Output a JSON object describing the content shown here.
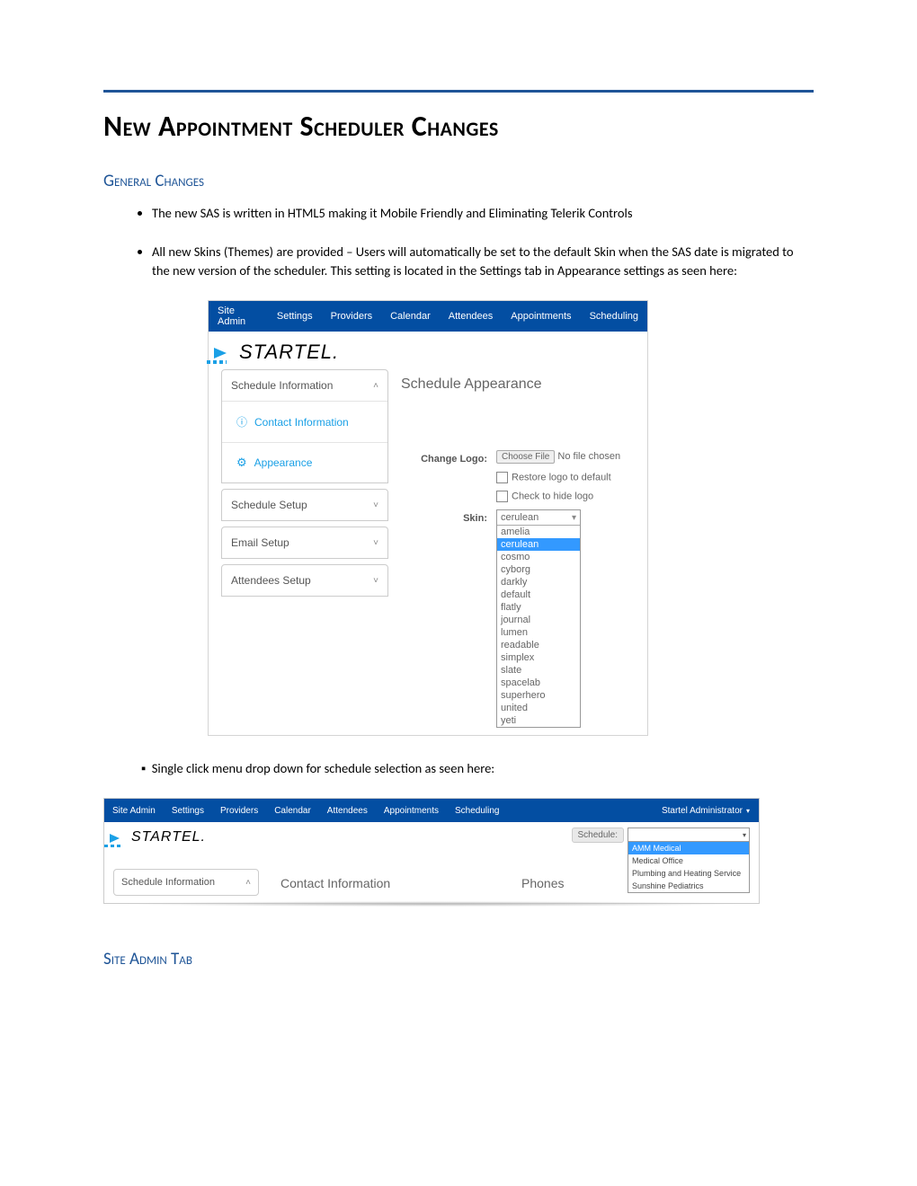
{
  "doc": {
    "title": "New Appointment Scheduler Changes",
    "section_general": "General Changes",
    "bullet1": "The new SAS is written in HTML5 making it Mobile Friendly and Eliminating Telerik Controls",
    "bullet2": "All new Skins (Themes) are provided – Users will automatically be set to the default Skin  when the SAS date is migrated to the new version of the scheduler.  This setting is located in the Settings tab in Appearance settings as seen here:",
    "bullet3": "Single click menu drop down for schedule selection as seen here:",
    "section_siteadmin": "Site Admin Tab"
  },
  "shot1": {
    "nav": [
      "Site Admin",
      "Settings",
      "Providers",
      "Calendar",
      "Attendees",
      "Appointments",
      "Scheduling"
    ],
    "logo": "STARTEL.",
    "side": {
      "schedule_info": "Schedule Information",
      "contact_info": "Contact Information",
      "appearance": "Appearance",
      "schedule_setup": "Schedule Setup",
      "email_setup": "Email Setup",
      "attendees_setup": "Attendees Setup"
    },
    "main": {
      "heading": "Schedule Appearance",
      "change_logo_label": "Change Logo:",
      "choose_file": "Choose File",
      "no_file": "No file chosen",
      "restore_logo": "Restore logo to default",
      "hide_logo": "Check to hide logo",
      "skin_label": "Skin:",
      "skin_selected": "cerulean",
      "skin_options": [
        "amelia",
        "cerulean",
        "cosmo",
        "cyborg",
        "darkly",
        "default",
        "flatly",
        "journal",
        "lumen",
        "readable",
        "simplex",
        "slate",
        "spacelab",
        "superhero",
        "united",
        "yeti"
      ]
    }
  },
  "shot2": {
    "nav": [
      "Site Admin",
      "Settings",
      "Providers",
      "Calendar",
      "Attendees",
      "Appointments",
      "Scheduling"
    ],
    "user": "Startel Administrator",
    "logo": "STARTEL.",
    "schedule_label": "Schedule:",
    "schedule_options": [
      "AMM Medical",
      "Medical Office",
      "Plumbing and Heating Service",
      "Sunshine Pediatrics"
    ],
    "schedule_info": "Schedule Information",
    "contact_info": "Contact Information",
    "phones": "Phones"
  }
}
